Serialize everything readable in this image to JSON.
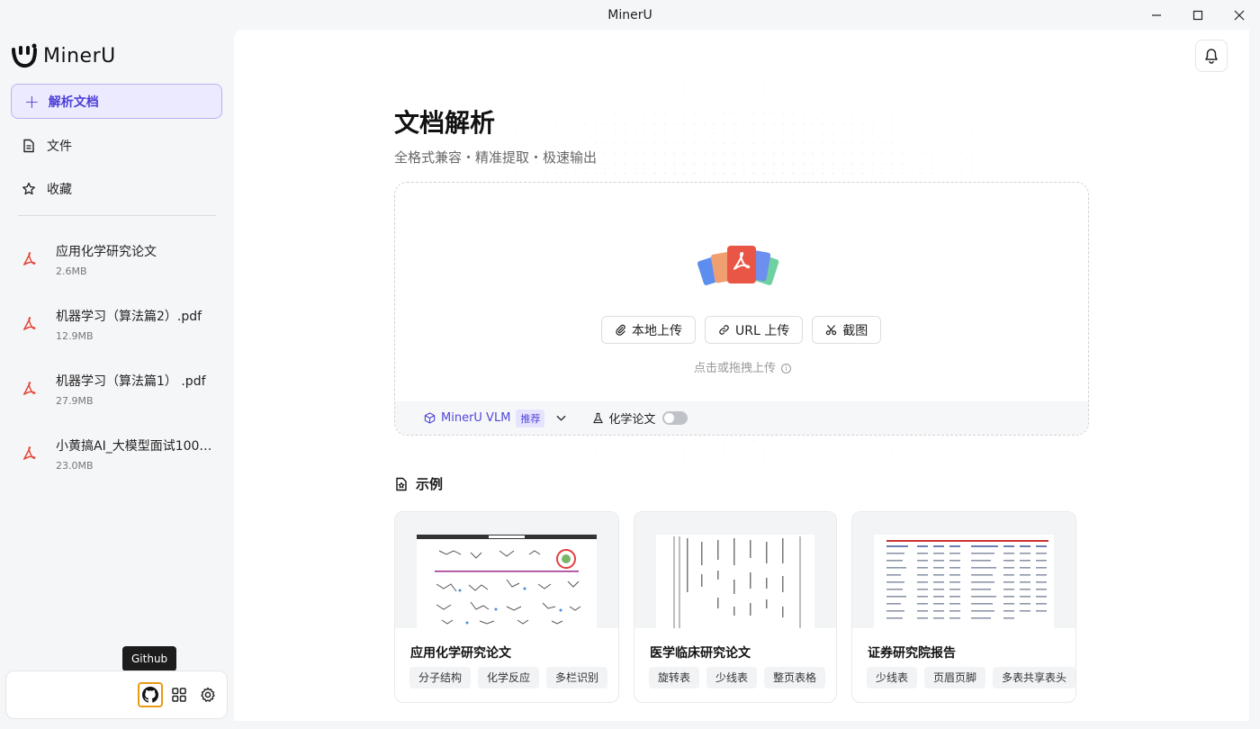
{
  "window": {
    "title": "MinerU"
  },
  "sidebar": {
    "brand": "MinerU",
    "new_label": "解析文档",
    "nav": [
      {
        "label": "文件",
        "icon": "file-icon"
      },
      {
        "label": "收藏",
        "icon": "star-icon"
      }
    ],
    "files": [
      {
        "name": "应用化学研究论文",
        "size": "2.6MB"
      },
      {
        "name": "机器学习（算法篇2）.pdf",
        "size": "12.9MB"
      },
      {
        "name": "机器学习（算法篇1） .pdf",
        "size": "27.9MB"
      },
      {
        "name": "小黄搞AI_大模型面试100…",
        "size": "23.0MB"
      }
    ],
    "tooltip": "Github"
  },
  "main": {
    "title": "文档解析",
    "subtitle": "全格式兼容・精准提取・极速输出",
    "upload": {
      "buttons": [
        "本地上传",
        "URL 上传",
        "截图"
      ],
      "hint": "点击或拖拽上传",
      "model": "MinerU VLM",
      "badge": "推荐",
      "chem_label": "化学论文"
    },
    "examples_title": "示例",
    "examples": [
      {
        "title": "应用化学研究论文",
        "tags": [
          "分子结构",
          "化学反应",
          "多栏识别"
        ]
      },
      {
        "title": "医学临床研究论文",
        "tags": [
          "旋转表",
          "少线表",
          "整页表格"
        ]
      },
      {
        "title": "证券研究院报告",
        "tags": [
          "少线表",
          "页眉页脚",
          "多表共享表头"
        ]
      }
    ]
  },
  "colors": {
    "accent": "#5247d8",
    "accent_bg": "#eceaff",
    "pdf_red": "#e5483b"
  }
}
